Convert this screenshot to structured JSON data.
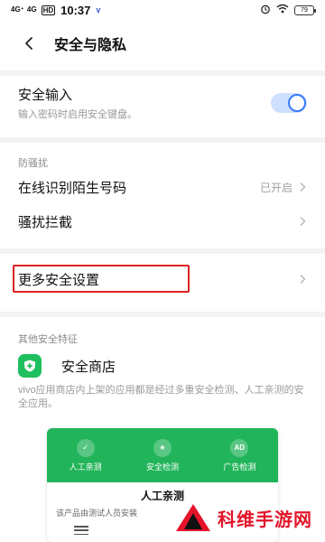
{
  "status_bar": {
    "signal_1": "4G⁺",
    "signal_2": "4G",
    "hd": "HD",
    "time": "10:37",
    "vivo_mark": "v",
    "battery": "79"
  },
  "header": {
    "title": "安全与隐私"
  },
  "secure_input": {
    "label": "安全输入",
    "subtitle": "输入密码时启用安全键盘。",
    "enabled": true
  },
  "anti_harassment": {
    "section_title": "防骚扰",
    "caller_id": {
      "label": "在线识别陌生号码",
      "status": "已开启"
    },
    "block": {
      "label": "骚扰拦截"
    }
  },
  "more_settings": {
    "label": "更多安全设置"
  },
  "other_features": {
    "section_title": "其他安全特征",
    "store": {
      "label": "安全商店"
    },
    "description": "vivo应用商店内上架的应用都是经过多重安全检测、人工亲测的安全应用。"
  },
  "card": {
    "badges": [
      {
        "label": "人工亲测",
        "icon": "check-shield-icon",
        "glyph": "✓"
      },
      {
        "label": "安全检测",
        "icon": "star-shield-icon",
        "glyph": "★"
      },
      {
        "label": "广告检测",
        "icon": "ad-icon",
        "glyph": "AD"
      }
    ],
    "title": "人工亲测",
    "text": "该产品由测试人员安装"
  },
  "watermark": {
    "text": "科维手游网"
  },
  "colors": {
    "accent": "#3a7bff",
    "store_green": "#1fbf5f",
    "highlight_red": "#e02020",
    "watermark_red": "#e3142a"
  }
}
